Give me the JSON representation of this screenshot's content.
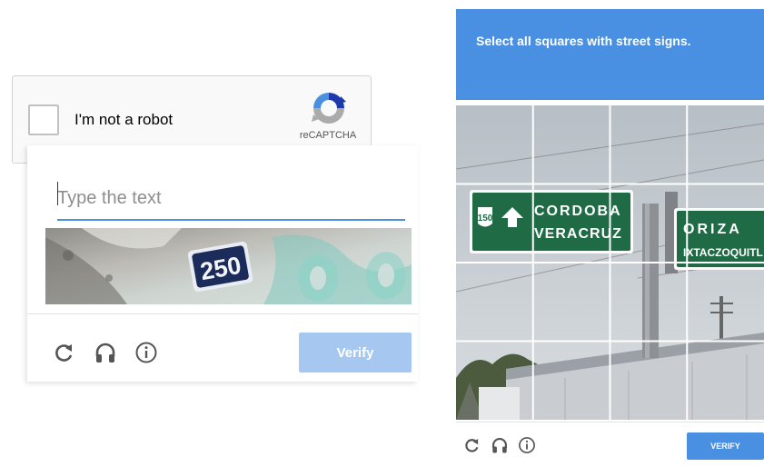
{
  "checkbox_widget": {
    "label": "I'm not a robot",
    "brand": "reCAPTCHA"
  },
  "text_challenge": {
    "input_placeholder": "Type the text",
    "input_value": "",
    "image_text": "250",
    "verify_label": "Verify",
    "icons": [
      "reload-icon",
      "audio-icon",
      "info-icon"
    ]
  },
  "image_challenge": {
    "prompt": "Select all squares with street signs.",
    "verify_label": "VERIFY",
    "grid": {
      "rows": 4,
      "cols": 4
    },
    "sign_left": {
      "shield": "150",
      "line1": "CORDOBA",
      "line2": "VERACRUZ"
    },
    "sign_right": {
      "line1": "ORIZA",
      "line2": "IXTACZOQUITL"
    },
    "icons": [
      "reload-icon",
      "audio-icon",
      "info-icon"
    ]
  },
  "colors": {
    "accent": "#4a90e2",
    "verify_disabled": "#a6c8f0",
    "sign_green": "#1e6b45"
  }
}
